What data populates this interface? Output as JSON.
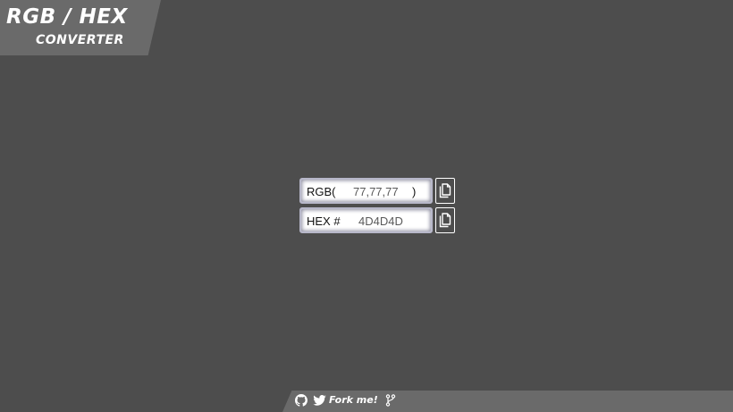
{
  "header": {
    "title_line1": "RGB / HEX",
    "title_line2": "CONVERTER"
  },
  "converter": {
    "rgb": {
      "prefix": "RGB(",
      "value": "77,77,77",
      "suffix": ")"
    },
    "hex": {
      "prefix": "HEX #",
      "value": "4D4D4D"
    },
    "copy_icon": "copy-document-icon"
  },
  "footer": {
    "link_text": "Fork me!",
    "icons": [
      "github-icon",
      "twitter-icon",
      "git-branch-icon"
    ]
  },
  "colors": {
    "background": "#4d4d4d",
    "banner": "#6a6a6a",
    "input_border": "#b7b7c9",
    "text_light": "#ffffff"
  }
}
